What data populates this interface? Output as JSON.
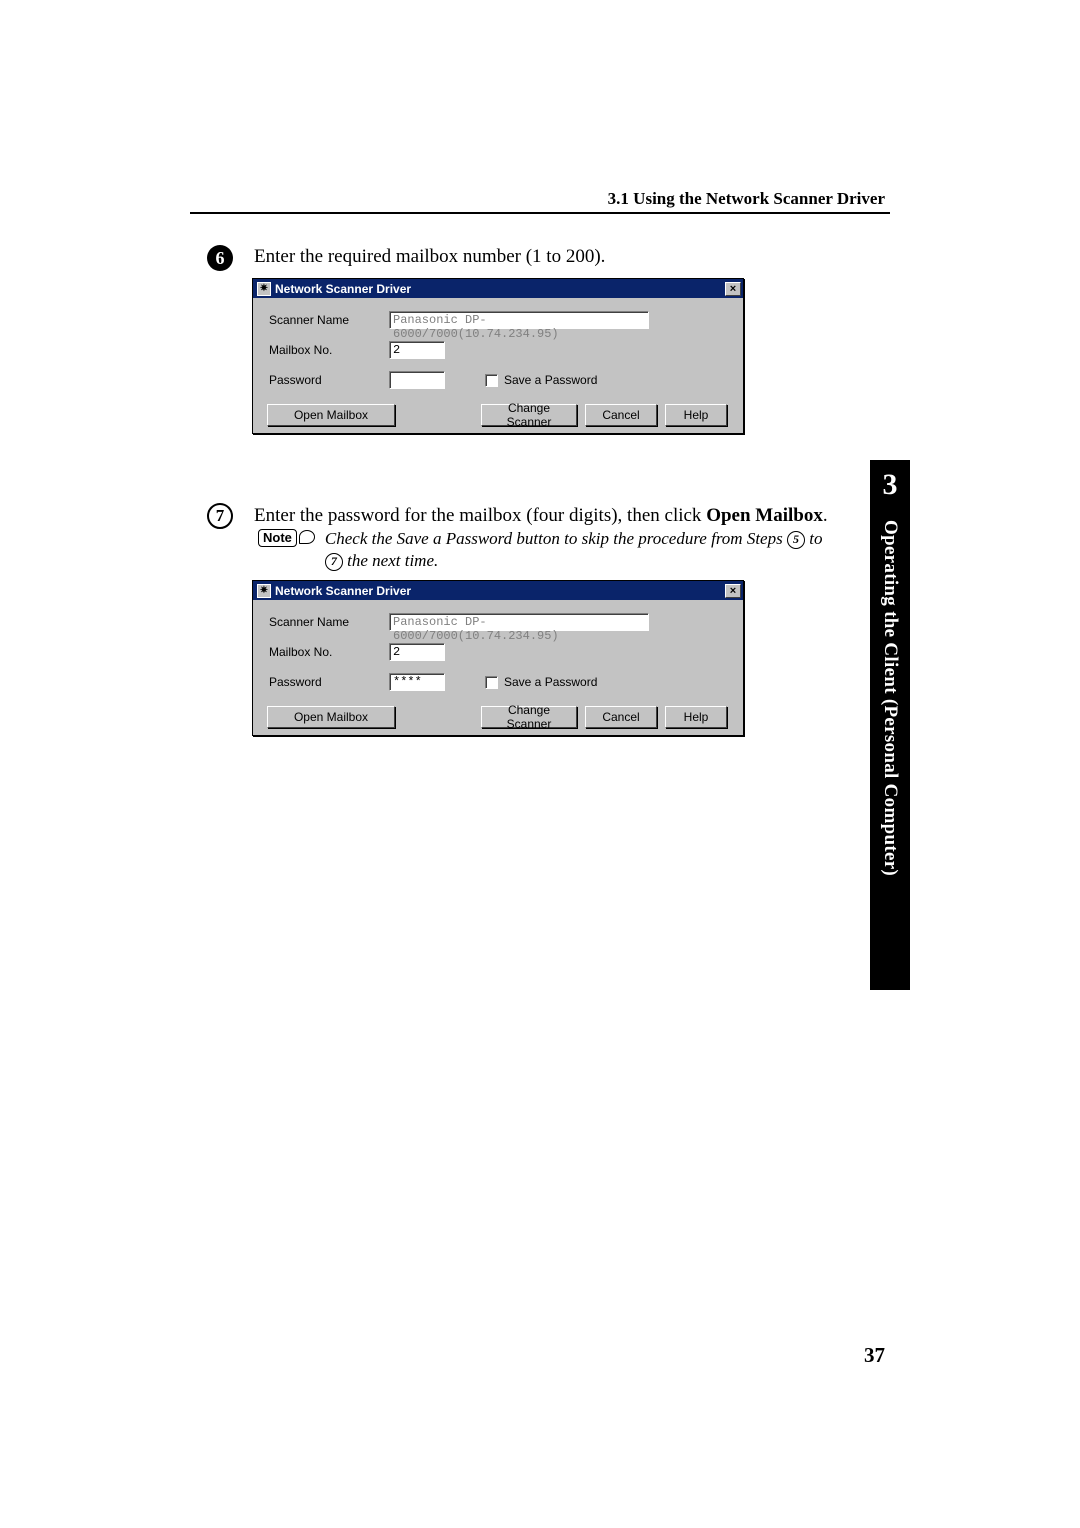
{
  "header": {
    "section": "3.1  Using the Network Scanner Driver"
  },
  "steps": {
    "s6": {
      "num": "6",
      "text": "Enter the required mailbox number (1 to 200)."
    },
    "s7": {
      "num": "7",
      "text_before": "Enter the password for the mailbox (four digits), then click ",
      "bold": "Open Mailbox",
      "text_after": "."
    }
  },
  "note": {
    "label": "Note",
    "text_a": "Check the Save a Password button to skip the procedure from Steps ",
    "five": "5",
    "text_b": " to ",
    "seven": "7",
    "text_c": " the next time."
  },
  "dialog": {
    "title": "Network Scanner Driver",
    "close": "×",
    "labels": {
      "scanner": "Scanner Name",
      "mailbox": "Mailbox No.",
      "password": "Password",
      "save": "Save a Password"
    },
    "values": {
      "scanner": "Panasonic DP-6000/7000(10.74.234.95)",
      "mailbox": "2",
      "password_empty": "",
      "password_masked": "****"
    },
    "buttons": {
      "open": "Open Mailbox",
      "change": "Change Scanner",
      "cancel": "Cancel",
      "help": "Help"
    }
  },
  "sidetab": {
    "chapter_num": "3",
    "chapter_title": "Operating the Client (Personal Computer)"
  },
  "page_number": "37"
}
